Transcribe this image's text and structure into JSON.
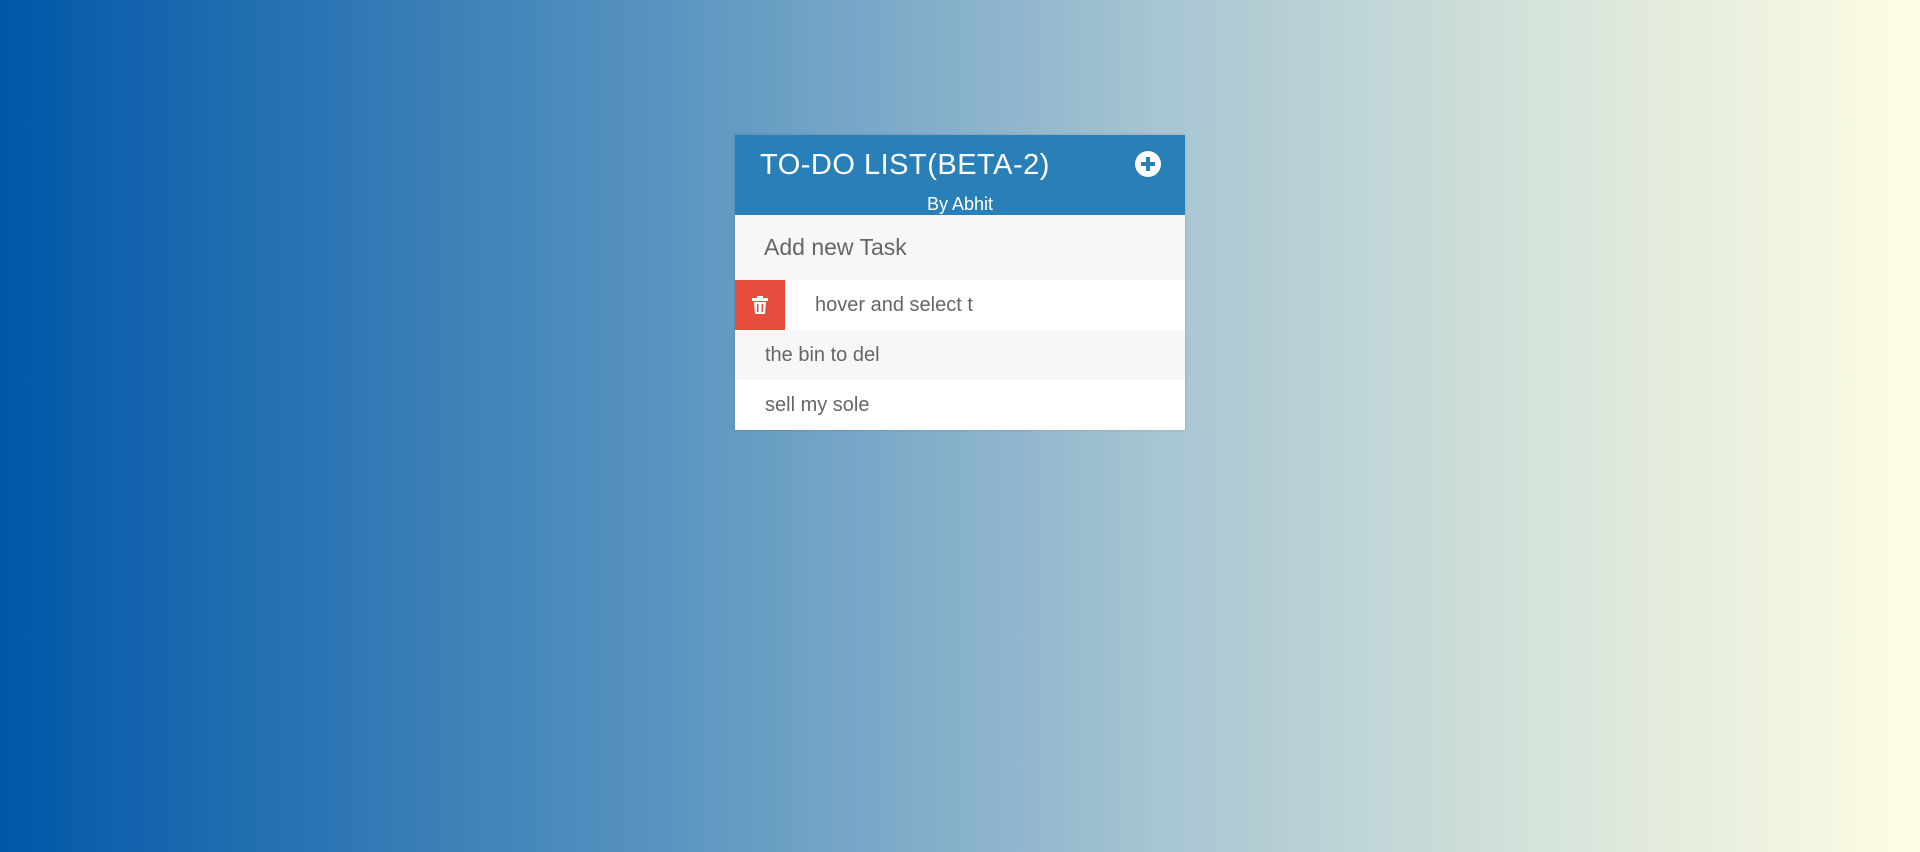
{
  "app": {
    "title": "TO-DO LIST(BETA-2)",
    "subtitle": "By Abhit",
    "add_icon": "plus-circle-icon",
    "accent_color": "#2980b9"
  },
  "input": {
    "placeholder": "Add new Task",
    "value": ""
  },
  "tasks": [
    {
      "text": "hover and select t",
      "delete_icon": "trash-icon",
      "delete_color": "#e74c3c",
      "hovered": true
    },
    {
      "text": "the bin to del",
      "hovered": false
    },
    {
      "text": "sell my sole",
      "hovered": false
    }
  ]
}
